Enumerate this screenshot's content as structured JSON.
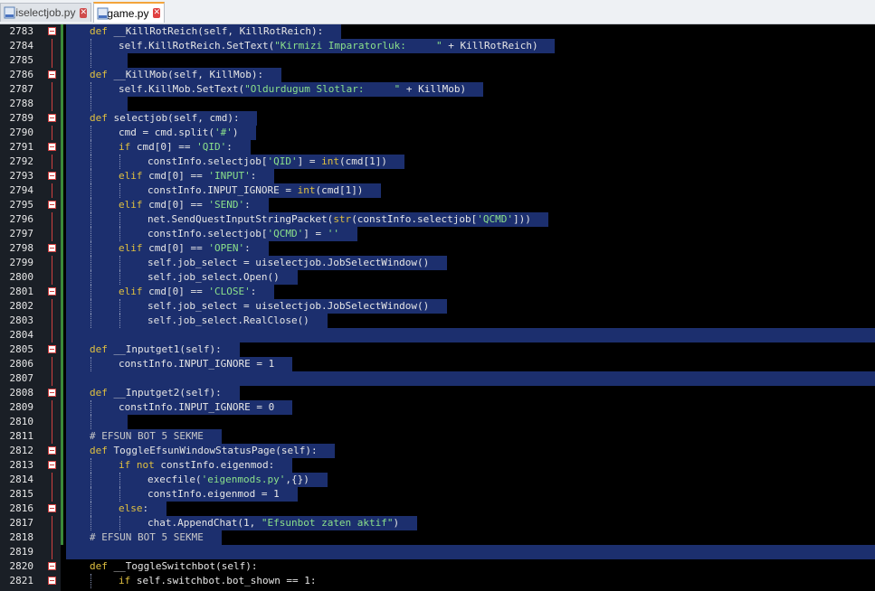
{
  "tabs": [
    {
      "label": "uiselectjob.py",
      "active": false,
      "icon": "python-file-icon"
    },
    {
      "label": "game.py",
      "active": true,
      "icon": "python-file-icon"
    }
  ],
  "colors": {
    "selection": "#1c2f6e",
    "keyword": "#e0c040",
    "string": "#8be08b",
    "gutter": "#1a1f26",
    "fold_marker": "#d04040",
    "change_marker": "#3a8a3a"
  },
  "lines": [
    {
      "n": "2783",
      "fold": true,
      "indent": 1,
      "text": "def __KillRotReich(self, KillRotReich):"
    },
    {
      "n": "2784",
      "fold": false,
      "indent": 2,
      "text": "self.KillRotReich.SetText(\"Kirmizi Imparatorluk:     \" + KillRotReich)"
    },
    {
      "n": "2785",
      "fold": false,
      "indent": 2,
      "text": ""
    },
    {
      "n": "2786",
      "fold": true,
      "indent": 1,
      "text": "def __KillMob(self, KillMob):"
    },
    {
      "n": "2787",
      "fold": false,
      "indent": 2,
      "text": "self.KillMob.SetText(\"Oldurdugum Slotlar:     \" + KillMob)"
    },
    {
      "n": "2788",
      "fold": false,
      "indent": 2,
      "text": ""
    },
    {
      "n": "2789",
      "fold": true,
      "indent": 1,
      "text": "def selectjob(self, cmd):"
    },
    {
      "n": "2790",
      "fold": false,
      "indent": 2,
      "text": "cmd = cmd.split('#')"
    },
    {
      "n": "2791",
      "fold": true,
      "indent": 2,
      "text": "if cmd[0] == 'QID':"
    },
    {
      "n": "2792",
      "fold": false,
      "indent": 3,
      "text": "constInfo.selectjob['QID'] = int(cmd[1])"
    },
    {
      "n": "2793",
      "fold": true,
      "indent": 2,
      "text": "elif cmd[0] == 'INPUT':"
    },
    {
      "n": "2794",
      "fold": false,
      "indent": 3,
      "text": "constInfo.INPUT_IGNORE = int(cmd[1])"
    },
    {
      "n": "2795",
      "fold": true,
      "indent": 2,
      "text": "elif cmd[0] == 'SEND':"
    },
    {
      "n": "2796",
      "fold": false,
      "indent": 3,
      "text": "net.SendQuestInputStringPacket(str(constInfo.selectjob['QCMD']))"
    },
    {
      "n": "2797",
      "fold": false,
      "indent": 3,
      "text": "constInfo.selectjob['QCMD'] = ''"
    },
    {
      "n": "2798",
      "fold": true,
      "indent": 2,
      "text": "elif cmd[0] == 'OPEN':"
    },
    {
      "n": "2799",
      "fold": false,
      "indent": 3,
      "text": "self.job_select = uiselectjob.JobSelectWindow()"
    },
    {
      "n": "2800",
      "fold": false,
      "indent": 3,
      "text": "self.job_select.Open()"
    },
    {
      "n": "2801",
      "fold": true,
      "indent": 2,
      "text": "elif cmd[0] == 'CLOSE':"
    },
    {
      "n": "2802",
      "fold": false,
      "indent": 3,
      "text": "self.job_select = uiselectjob.JobSelectWindow()"
    },
    {
      "n": "2803",
      "fold": false,
      "indent": 3,
      "text": "self.job_select.RealClose()"
    },
    {
      "n": "2804",
      "fold": false,
      "indent": 0,
      "text": ""
    },
    {
      "n": "2805",
      "fold": true,
      "indent": 1,
      "text": "def __Inputget1(self):"
    },
    {
      "n": "2806",
      "fold": false,
      "indent": 2,
      "text": "constInfo.INPUT_IGNORE = 1"
    },
    {
      "n": "2807",
      "fold": false,
      "indent": 0,
      "text": ""
    },
    {
      "n": "2808",
      "fold": true,
      "indent": 1,
      "text": "def __Inputget2(self):"
    },
    {
      "n": "2809",
      "fold": false,
      "indent": 2,
      "text": "constInfo.INPUT_IGNORE = 0"
    },
    {
      "n": "2810",
      "fold": false,
      "indent": 2,
      "text": ""
    },
    {
      "n": "2811",
      "fold": false,
      "indent": 1,
      "text": "# EFSUN BOT 5 SEKME"
    },
    {
      "n": "2812",
      "fold": true,
      "indent": 1,
      "text": "def ToggleEfsunWindowStatusPage(self):"
    },
    {
      "n": "2813",
      "fold": true,
      "indent": 2,
      "text": "if not constInfo.eigenmod:"
    },
    {
      "n": "2814",
      "fold": false,
      "indent": 3,
      "text": "execfile('eigenmods.py',{})"
    },
    {
      "n": "2815",
      "fold": false,
      "indent": 3,
      "text": "constInfo.eigenmod = 1"
    },
    {
      "n": "2816",
      "fold": true,
      "indent": 2,
      "text": "else:"
    },
    {
      "n": "2817",
      "fold": false,
      "indent": 3,
      "text": "chat.AppendChat(1, \"Efsunbot zaten aktif\")"
    },
    {
      "n": "2818",
      "fold": false,
      "indent": 1,
      "text": "# EFSUN BOT 5 SEKME"
    },
    {
      "n": "2819",
      "fold": false,
      "indent": 0,
      "text": ""
    },
    {
      "n": "2820",
      "fold": true,
      "indent": 1,
      "text": "def __ToggleSwitchbot(self):"
    },
    {
      "n": "2821",
      "fold": true,
      "indent": 2,
      "text": "if self.switchbot.bot_shown == 1:"
    }
  ]
}
